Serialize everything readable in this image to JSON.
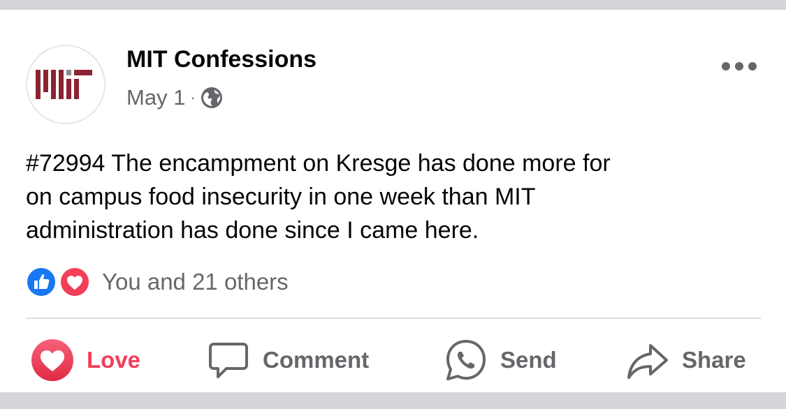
{
  "post": {
    "page_name": "MIT Confessions",
    "date": "May 1",
    "separator": "·",
    "privacy_icon": "globe-icon",
    "more_icon": "more-horizontal-icon",
    "text": "#72994 The encampment on Kresge has done more for\non campus food insecurity in one week than MIT\nadministration has done since I came here."
  },
  "avatar": {
    "logo_text": "MIT",
    "logo_color": "#8b2332",
    "logo_gray": "#8a8b8c"
  },
  "reactions": {
    "icons": [
      "like-reaction-icon",
      "love-reaction-icon"
    ],
    "summary": "You and 21 others"
  },
  "actions": {
    "love_label": "Love",
    "comment_label": "Comment",
    "send_label": "Send",
    "share_label": "Share"
  },
  "colors": {
    "love": "#f33e58",
    "like": "#1877f2",
    "secondary_text": "#65676b"
  }
}
